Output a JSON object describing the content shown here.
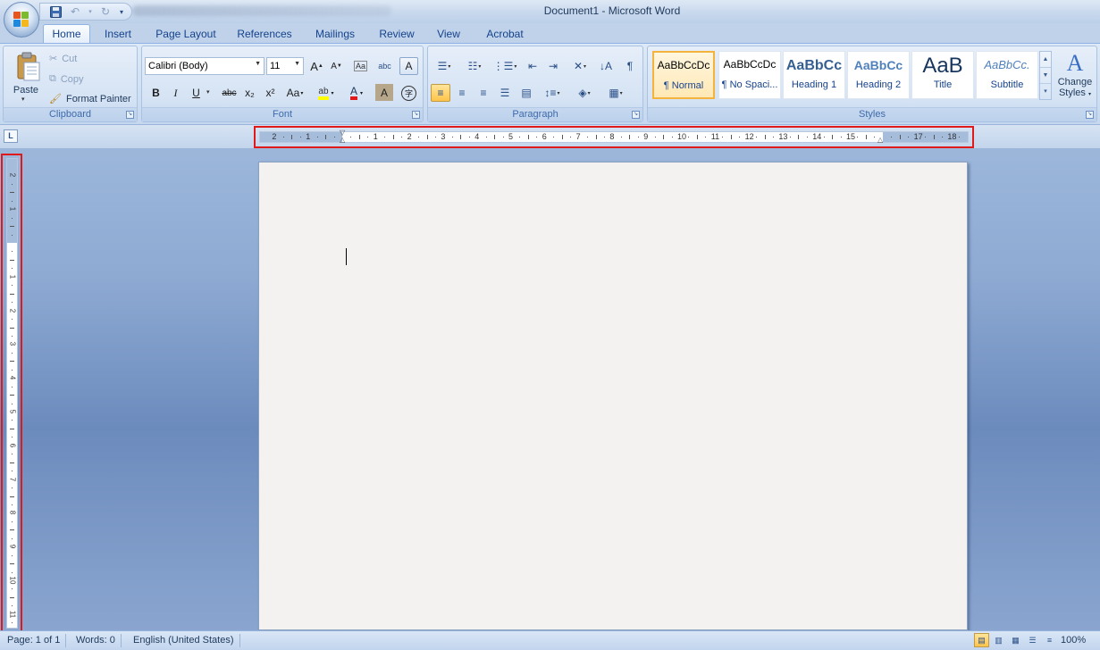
{
  "window": {
    "title": "Document1 - Microsoft Word"
  },
  "quick_access": {
    "save_icon": "save-icon",
    "undo_icon": "undo-icon",
    "redo_icon": "redo-icon",
    "customize_icon": "chevron-down-icon"
  },
  "tabs": [
    {
      "label": "Home"
    },
    {
      "label": "Insert"
    },
    {
      "label": "Page Layout"
    },
    {
      "label": "References"
    },
    {
      "label": "Mailings"
    },
    {
      "label": "Review"
    },
    {
      "label": "View"
    },
    {
      "label": "Acrobat"
    }
  ],
  "clipboard": {
    "paste_label": "Paste",
    "cut_label": "Cut",
    "copy_label": "Copy",
    "format_painter_label": "Format Painter",
    "group_label": "Clipboard"
  },
  "font": {
    "font_name": "Calibri (Body)",
    "font_size": "11",
    "group_label": "Font",
    "bold": "B",
    "italic": "I",
    "underline": "U",
    "strikethrough": "abc",
    "subscript": "x₂",
    "superscript": "x²",
    "change_case": "Aa",
    "grow": "A",
    "shrink": "A",
    "clear_formatting": "Aa",
    "phonetic": "abc",
    "char_border": "A",
    "highlight": "ab",
    "font_color": "A",
    "char_shading": "A",
    "enclose": "字"
  },
  "paragraph": {
    "group_label": "Paragraph",
    "show_marks": "¶"
  },
  "styles": {
    "group_label": "Styles",
    "items": [
      {
        "sample": "AaBbCcDc",
        "name": "¶ Normal"
      },
      {
        "sample": "AaBbCcDc",
        "name": "¶ No Spaci..."
      },
      {
        "sample": "AaBbCc",
        "name": "Heading 1"
      },
      {
        "sample": "AaBbCc",
        "name": "Heading 2"
      },
      {
        "sample": "AaB",
        "name": "Title"
      },
      {
        "sample": "AaBbCc.",
        "name": "Subtitle"
      }
    ],
    "change_styles_line1": "Change",
    "change_styles_line2": "Styles"
  },
  "ruler": {
    "tab_selector": "L",
    "horizontal_labels": [
      "2",
      "1",
      "1",
      "2",
      "3",
      "4",
      "5",
      "6",
      "7",
      "8",
      "9",
      "10",
      "11",
      "12",
      "13",
      "14",
      "15",
      "17",
      "18"
    ],
    "vertical_labels": [
      "2",
      "1",
      "1",
      "2",
      "3",
      "4",
      "5",
      "6",
      "7",
      "8",
      "9",
      "10",
      "11"
    ]
  },
  "status": {
    "page": "Page: 1 of 1",
    "words": "Words: 0",
    "language": "English (United States)",
    "zoom": "100%"
  },
  "colors": {
    "accent": "#15428b",
    "ruler_highlight": "#e01a1a",
    "selected_style": "#f3b33d"
  }
}
